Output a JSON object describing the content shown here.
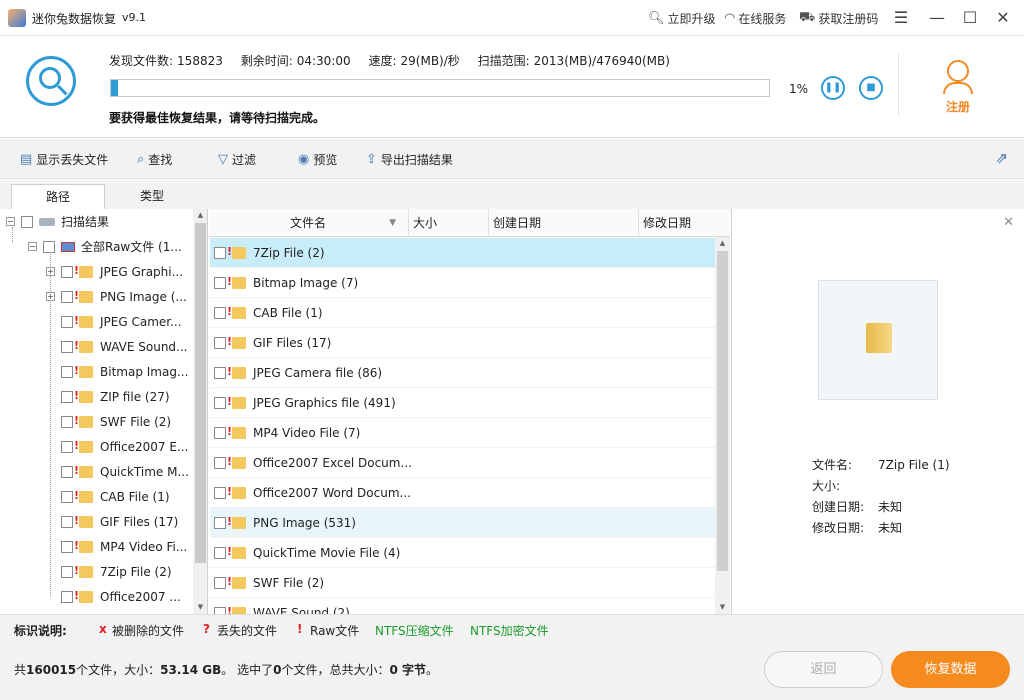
{
  "window": {
    "title": "迷你兔数据恢复",
    "version": "v9.1",
    "links": [
      "立即升级",
      "在线服务",
      "获取注册码"
    ]
  },
  "scan": {
    "found_label": "发现文件数:",
    "found_value": "158823",
    "remaining_label": "剩余时间:",
    "remaining_value": "04:30:00",
    "speed_label": "速度:",
    "speed_value": "29(MB)/秒",
    "range_label": "扫描范围:",
    "range_value": "2013(MB)/476940(MB)",
    "progress": 0.01,
    "percent": "1%",
    "hint": "要获得最佳恢复结果，请等待扫描完成。",
    "register_label": "注册",
    "accent": "#2f9bd6",
    "orange": "#f08a24"
  },
  "toolbar": {
    "show_lost": "显示丢失文件",
    "find": "查找",
    "filter": "过滤",
    "preview": "预览",
    "export": "导出扫描结果"
  },
  "tabs": [
    "路径",
    "类型"
  ],
  "tree": {
    "root": "扫描结果",
    "raw": "全部Raw文件 (1...",
    "items": [
      "JPEG Graphi...",
      "PNG Image (...",
      "JPEG Camer...",
      "WAVE Sound...",
      "Bitmap Imag...",
      "ZIP file (27)",
      "SWF File (2)",
      "Office2007 E...",
      "QuickTime M...",
      "CAB File (1)",
      "GIF Files (17)",
      "MP4 Video Fi...",
      "7Zip File (2)",
      "Office2007 ..."
    ]
  },
  "filelist": {
    "columns": [
      "文件名",
      "大小",
      "创建日期",
      "修改日期"
    ],
    "rows": [
      "7Zip File (2)",
      "Bitmap Image (7)",
      "CAB File (1)",
      "GIF Files (17)",
      "JPEG Camera file (86)",
      "JPEG Graphics file (491)",
      "MP4 Video File (7)",
      "Office2007 Excel Docum...",
      "Office2007 Word Docum...",
      "PNG Image (531)",
      "QuickTime Movie File (4)",
      "SWF File (2)",
      "WAVE Sound (2)"
    ]
  },
  "preview": {
    "name_label": "文件名:",
    "name_value": "7Zip File (1)",
    "size_label": "大小:",
    "size_value": "",
    "created_label": "创建日期:",
    "created_value": "未知",
    "modified_label": "修改日期:",
    "modified_value": "未知"
  },
  "legend": {
    "title": "标识说明:",
    "deleted": "被删除的文件",
    "lost": "丢失的文件",
    "raw": "Raw文件",
    "ntfs_compressed": "NTFS压缩文件",
    "ntfs_encrypted": "NTFS加密文件"
  },
  "summary": {
    "p1": "共",
    "total_files": "160015",
    "p2": "个文件，大小：",
    "total_size": "53.14 GB",
    "p3": "。 选中了",
    "selected_count": "0",
    "p4": "个文件，总共大小：",
    "selected_size": "0 字节",
    "p5": "。"
  },
  "buttons": {
    "back": "返回",
    "recover": "恢复数据"
  }
}
